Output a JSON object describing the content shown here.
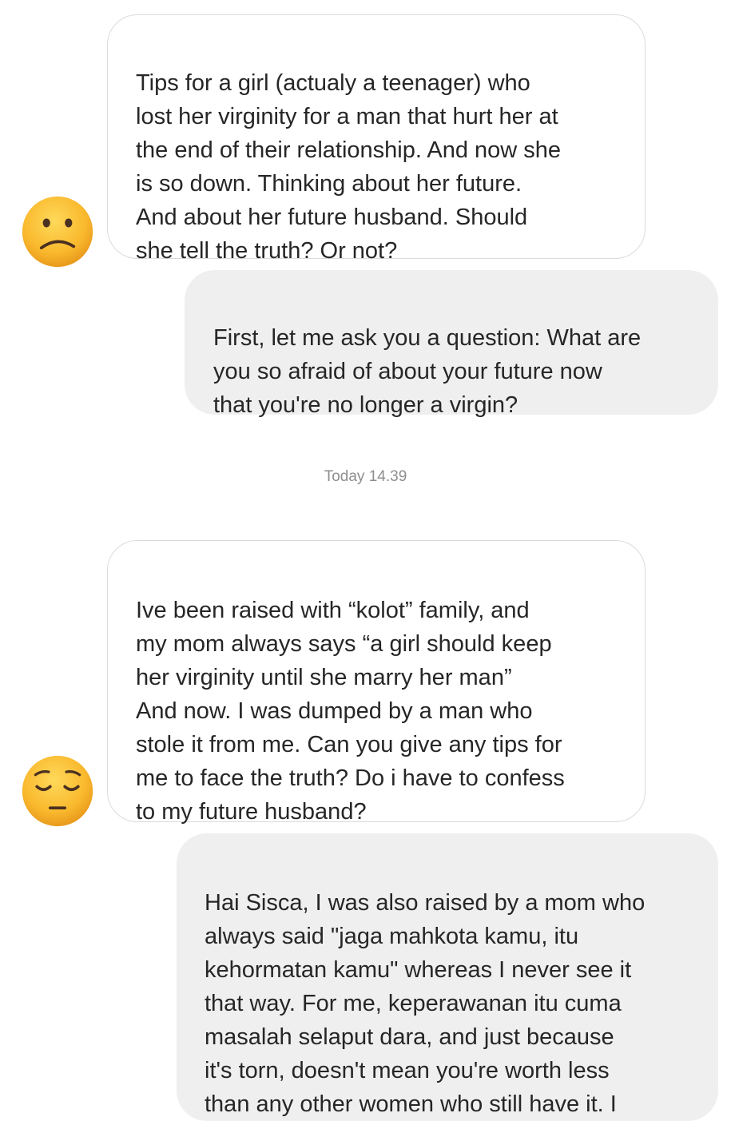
{
  "conversation": {
    "messages": [
      {
        "sender": "other",
        "avatar_icon": "confused-face-emoji",
        "text": "Tips for a girl (actualy a teenager) who\nlost her virginity for a man that hurt her at\nthe end of their relationship. And now she\nis so down. Thinking about her future.\nAnd about her future husband. Should\nshe tell the truth? Or not?"
      },
      {
        "sender": "me",
        "text": "First, let me ask you a question: What are\nyou so afraid of about your future now\nthat you're no longer a virgin?"
      },
      {
        "sender": "other",
        "avatar_icon": "pensive-face-emoji",
        "text": "Ive been raised with “kolot” family, and\nmy mom always says “a girl should keep\nher virginity until she marry her man”\nAnd now. I was dumped by a man who\nstole it from me. Can you give any tips for\nme to face the truth? Do i have to confess\nto my future husband?"
      },
      {
        "sender": "me",
        "text": "Hai Sisca, I was also raised by a mom who\nalways said \"jaga mahkota kamu, itu\nkehormatan kamu\" whereas I never see it\nthat way. For me, keperawanan itu cuma\nmasalah selaput dara, and just because\nit's torn, doesn't mean you're worth less\nthan any other women who still have it. I"
      }
    ],
    "timestamp": "Today 14.39"
  },
  "colors": {
    "received_bubble_border": "#dbdbdb",
    "sent_bubble_bg": "#efefef",
    "text": "#262626",
    "timestamp": "#8e8e8e",
    "emoji_face": "#f7b731"
  }
}
